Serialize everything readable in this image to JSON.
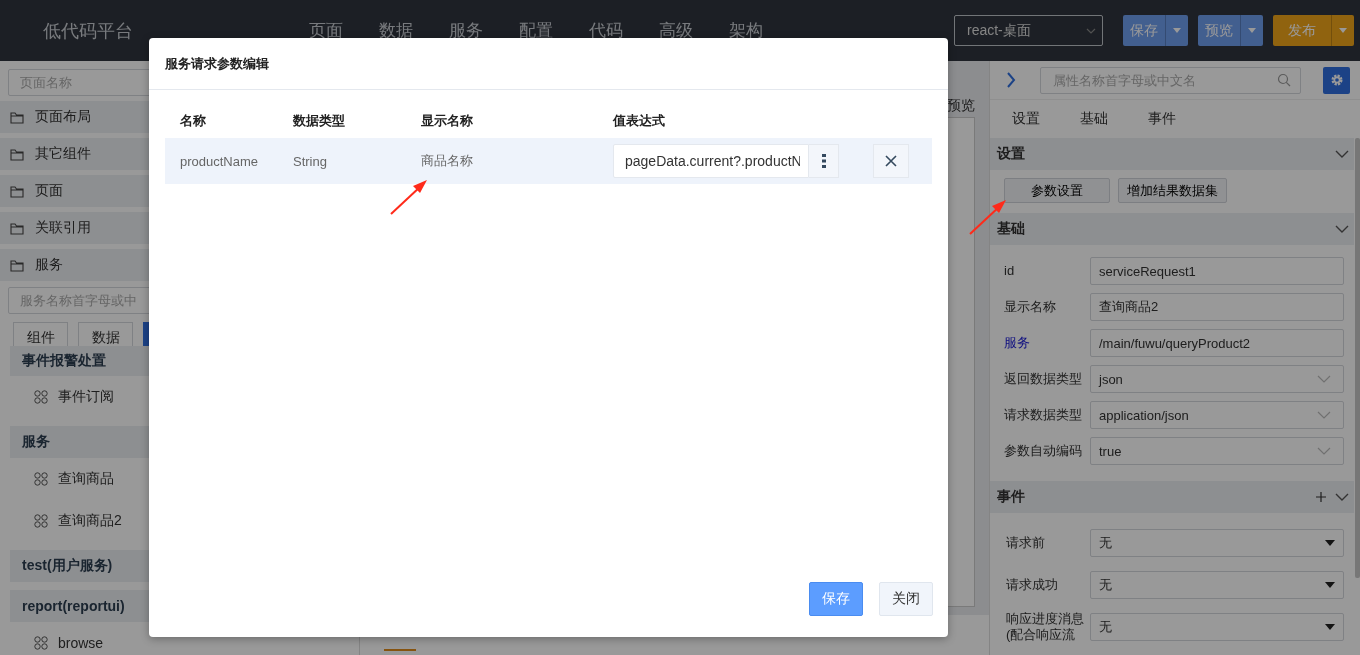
{
  "header": {
    "logo": "低代码平台",
    "nav": [
      {
        "label": "页面"
      },
      {
        "label": "数据"
      },
      {
        "label": "服务"
      },
      {
        "label": "配置"
      },
      {
        "label": "代码"
      },
      {
        "label": "高级"
      },
      {
        "label": "架构"
      }
    ],
    "target_select": {
      "value": "react-桌面"
    },
    "actions": [
      {
        "label": "保存",
        "kind": "primary"
      },
      {
        "label": "预览",
        "kind": "primary"
      },
      {
        "label": "发布",
        "kind": "warning"
      }
    ]
  },
  "left_panel": {
    "page_search": {
      "placeholder": "页面名称"
    },
    "folders": [
      {
        "label": "页面布局"
      },
      {
        "label": "其它组件"
      },
      {
        "label": "页面"
      },
      {
        "label": "关联引用"
      },
      {
        "label": "服务"
      }
    ],
    "service_search": {
      "placeholder": "服务名称首字母或中"
    },
    "tabs": [
      {
        "label": "组件",
        "selected": false
      },
      {
        "label": "数据",
        "selected": false
      },
      {
        "selected": true
      }
    ],
    "groups": [
      {
        "title": "事件报警处置",
        "items": [
          "事件订阅"
        ]
      },
      {
        "title": "服务",
        "items": [
          "查询商品",
          "查询商品2"
        ]
      },
      {
        "title": "test(用户服务)"
      },
      {
        "title": "report(reportui)",
        "items": [
          "browse"
        ]
      }
    ]
  },
  "canvas": {
    "label": "预览"
  },
  "right_panel": {
    "search": {
      "placeholder": "属性名称首字母或中文名"
    },
    "tabs": [
      {
        "label": "设置"
      },
      {
        "label": "基础"
      },
      {
        "label": "事件"
      }
    ],
    "sections": [
      {
        "title": "设置",
        "buttons": [
          "参数设置",
          "增加结果数据集"
        ]
      },
      {
        "title": "基础",
        "fields": [
          {
            "label": "id",
            "kind": "text",
            "value": "serviceRequest1"
          },
          {
            "label": "显示名称",
            "kind": "text",
            "value": "查询商品2"
          },
          {
            "label": "服务",
            "kind": "link",
            "value": "/main/fuwu/queryProduct2"
          },
          {
            "label": "返回数据类型",
            "kind": "select",
            "value": "json"
          },
          {
            "label": "请求数据类型",
            "kind": "select",
            "value": "application/json"
          },
          {
            "label": "参数自动编码",
            "kind": "select",
            "value": "true"
          }
        ]
      },
      {
        "title": "事件",
        "addable": true,
        "fields": [
          {
            "label": "请求前",
            "kind": "dropdown",
            "value": "无"
          },
          {
            "label": "请求成功",
            "kind": "dropdown",
            "value": "无"
          },
          {
            "label": "响应进度消息(配合响应流",
            "kind": "dropdown",
            "value": "无"
          }
        ]
      }
    ]
  },
  "modal": {
    "title": "服务请求参数编辑",
    "columns": [
      "名称",
      "数据类型",
      "显示名称",
      "值表达式"
    ],
    "rows": [
      {
        "name": "productName",
        "type": "String",
        "display_name": "商品名称",
        "expression": "pageData.current?.productN"
      }
    ],
    "buttons": [
      {
        "label": "保存",
        "kind": "primary"
      },
      {
        "label": "关闭",
        "kind": "default"
      }
    ]
  }
}
